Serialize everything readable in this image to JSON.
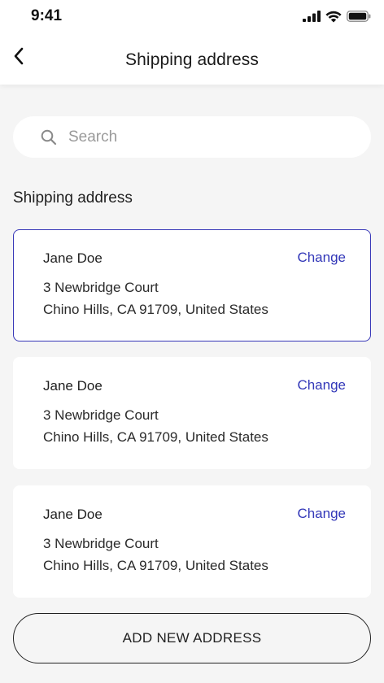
{
  "status_bar": {
    "time": "9:41"
  },
  "header": {
    "title": "Shipping address"
  },
  "search": {
    "placeholder": "Search",
    "value": ""
  },
  "section": {
    "title": "Shipping address"
  },
  "addresses": [
    {
      "name": "Jane Doe",
      "line1": "3 Newbridge Court",
      "line2": "Chino Hills, CA 91709, United States",
      "action": "Change",
      "selected": true
    },
    {
      "name": "Jane Doe",
      "line1": "3 Newbridge Court",
      "line2": "Chino Hills, CA 91709, United States",
      "action": "Change",
      "selected": false
    },
    {
      "name": "Jane Doe",
      "line1": "3 Newbridge Court",
      "line2": "Chino Hills, CA 91709, United States",
      "action": "Change",
      "selected": false
    }
  ],
  "add_button": {
    "label": "ADD NEW ADDRESS"
  },
  "colors": {
    "accent": "#3237b8",
    "selected_border": "#3838b8",
    "background": "#f5f5f5"
  },
  "icons": {
    "back": "chevron-left-icon",
    "search": "search-icon",
    "signal": "cellular-signal-icon",
    "wifi": "wifi-icon",
    "battery": "battery-icon"
  }
}
